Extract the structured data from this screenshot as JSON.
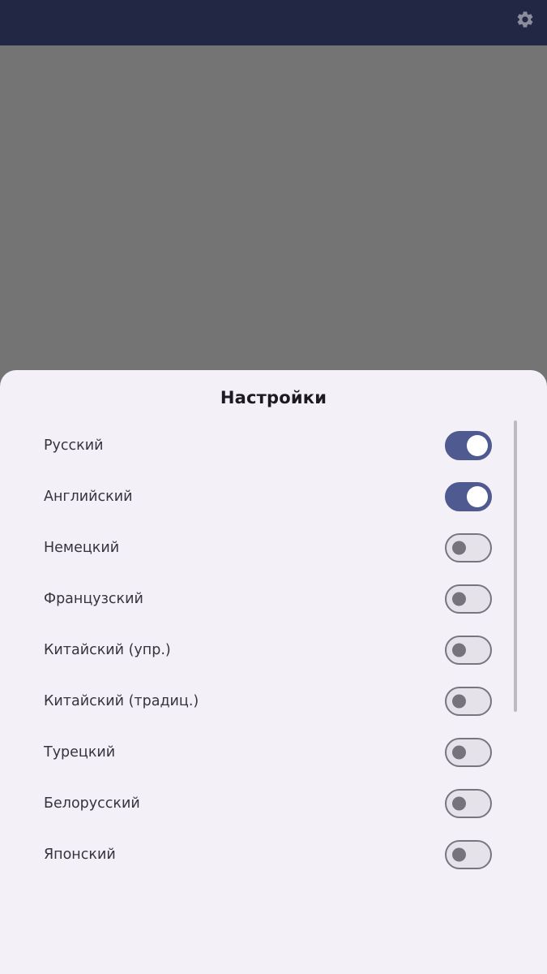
{
  "topbar": {
    "background": "#222844",
    "settings_icon": "gear-icon",
    "icon_color": "#8a8d9c"
  },
  "sheet": {
    "title": "Настройки",
    "background": "#f3f0f7",
    "accent": "#4f5a90",
    "languages": [
      {
        "label": "Русский",
        "enabled": true
      },
      {
        "label": "Английский",
        "enabled": true
      },
      {
        "label": "Немецкий",
        "enabled": false
      },
      {
        "label": "Французский",
        "enabled": false
      },
      {
        "label": "Китайский (упр.)",
        "enabled": false
      },
      {
        "label": "Китайский (традиц.)",
        "enabled": false
      },
      {
        "label": "Турецкий",
        "enabled": false
      },
      {
        "label": "Белорусский",
        "enabled": false
      },
      {
        "label": "Японский",
        "enabled": false
      }
    ]
  }
}
